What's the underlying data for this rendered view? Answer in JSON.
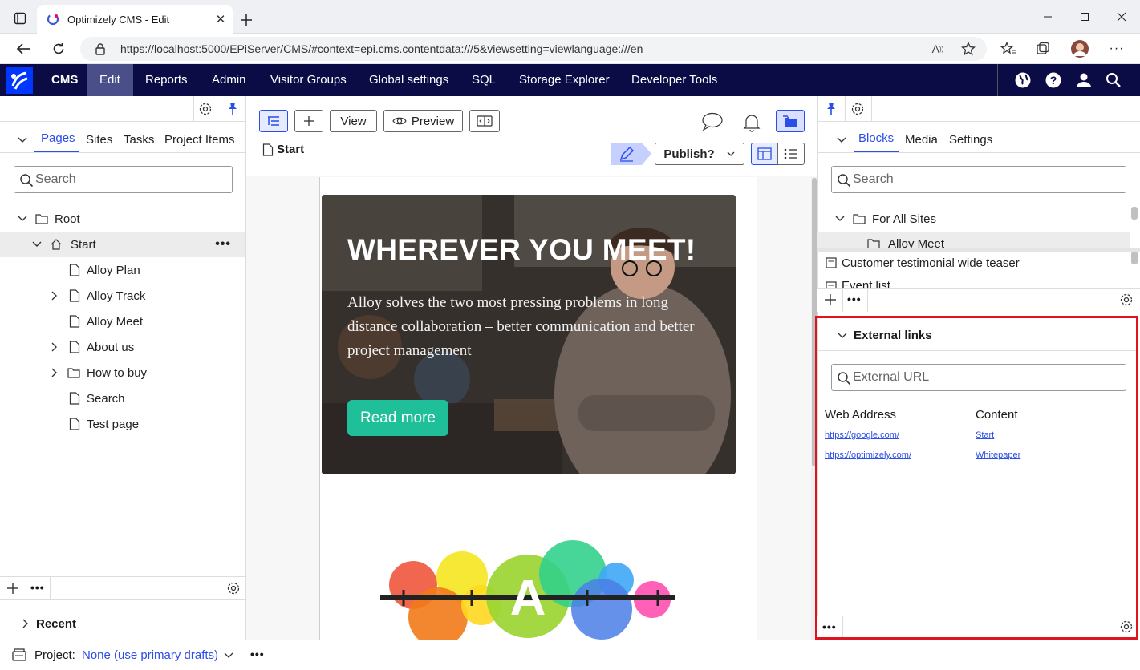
{
  "browser": {
    "tab_title": "Optimizely CMS - Edit",
    "url": "https://localhost:5000/EPiServer/CMS/#context=epi.cms.contentdata:///5&viewsetting=viewlanguage:///en"
  },
  "nav": {
    "items": [
      "CMS",
      "Edit",
      "Reports",
      "Admin",
      "Visitor Groups",
      "Global settings",
      "SQL",
      "Storage Explorer",
      "Developer Tools"
    ],
    "active": "Edit"
  },
  "left": {
    "tabs": [
      "Pages",
      "Sites",
      "Tasks",
      "Project Items"
    ],
    "search_placeholder": "Search",
    "tree": [
      {
        "label": "Root"
      },
      {
        "label": "Start"
      },
      {
        "label": "Alloy Plan"
      },
      {
        "label": "Alloy Track"
      },
      {
        "label": "Alloy Meet"
      },
      {
        "label": "About us"
      },
      {
        "label": "How to buy"
      },
      {
        "label": "Search"
      },
      {
        "label": "Test page"
      }
    ],
    "recent_label": "Recent"
  },
  "center": {
    "view_label": "View",
    "preview_label": "Preview",
    "page_name": "Start",
    "publish_label": "Publish?",
    "hero": {
      "title": "WHEREVER YOU MEET!",
      "body": "Alloy solves the two most pressing problems in long distance collaboration – better communication and better project management",
      "button": "Read more"
    },
    "logo_letter": "A"
  },
  "right": {
    "tabs": [
      "Blocks",
      "Media",
      "Settings"
    ],
    "search_placeholder": "Search",
    "tree": [
      {
        "label": "For All Sites"
      },
      {
        "label": "Alloy Meet"
      }
    ],
    "blocks": [
      "Customer testimonial wide teaser",
      "Event list"
    ],
    "external_links": {
      "title": "External links",
      "placeholder": "External URL",
      "col_web": "Web Address",
      "col_content": "Content",
      "rows": [
        {
          "url": "https://google.com/",
          "content": "Start"
        },
        {
          "url": "https://optimizely.com/",
          "content": "Whitepaper"
        }
      ]
    },
    "highlight_color": "#e0141e"
  },
  "status": {
    "project_label": "Project:",
    "project_value": "None (use primary drafts)"
  }
}
